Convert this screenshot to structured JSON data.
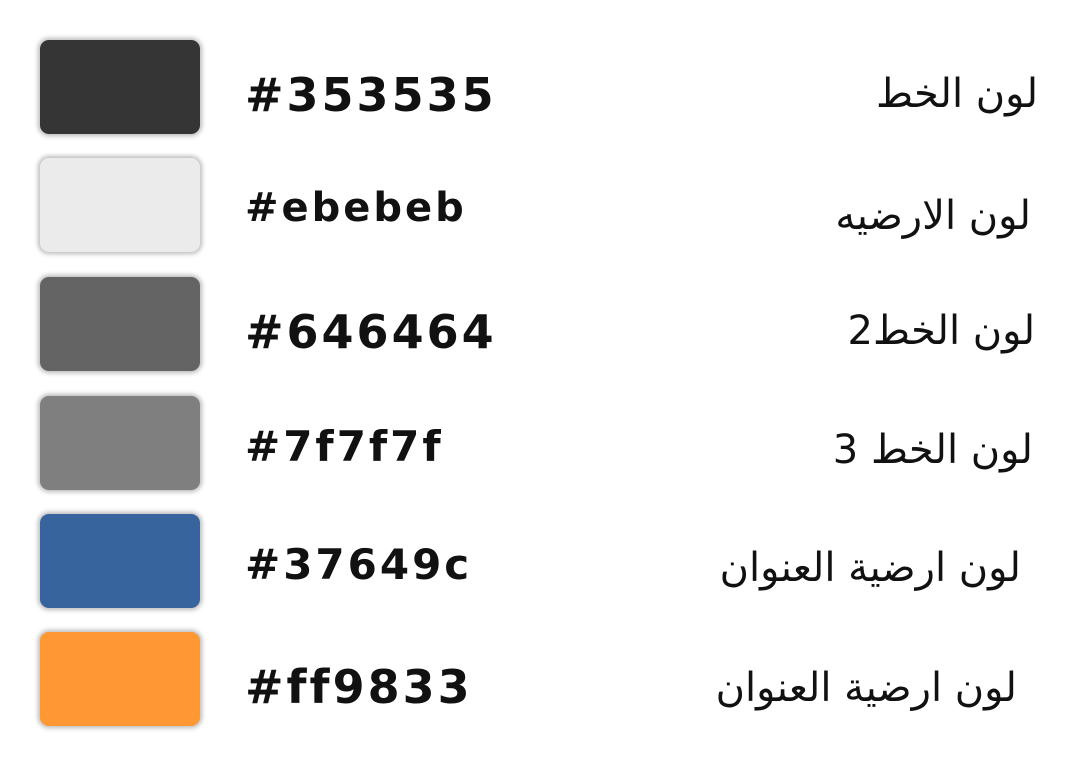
{
  "colors": [
    {
      "hex": "#353535",
      "label": "لون الخط",
      "swatch": "#353535"
    },
    {
      "hex": "#ebebeb",
      "label": "لون الارضيه",
      "swatch": "#ebebeb"
    },
    {
      "hex": "#646464",
      "label": "لون الخط2",
      "swatch": "#646464"
    },
    {
      "hex": "#7f7f7f",
      "label": "لون الخط 3",
      "swatch": "#7f7f7f"
    },
    {
      "hex": "#37649c",
      "label": "لون ارضية العنوان",
      "swatch": "#37649c"
    },
    {
      "hex": "#ff9833",
      "label": "لون ارضية العنوان",
      "swatch": "#ff9833"
    }
  ]
}
